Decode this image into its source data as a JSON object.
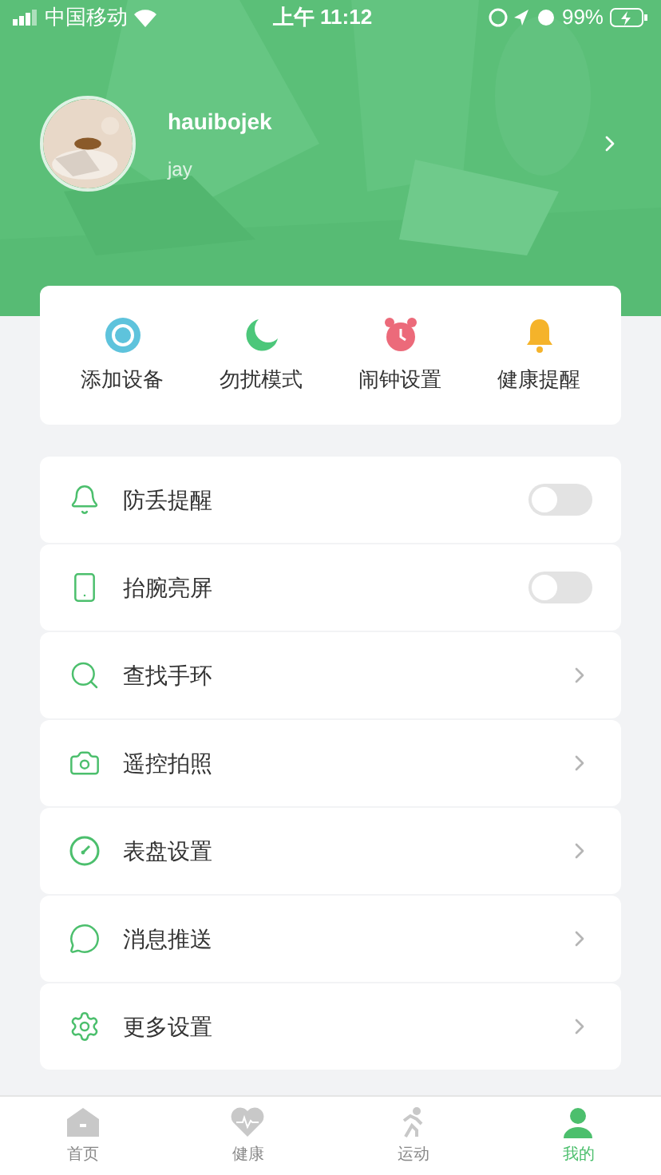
{
  "status_bar": {
    "carrier": "中国移动",
    "time": "上午 11:12",
    "battery": "99%"
  },
  "profile": {
    "username": "hauibojek",
    "nickname": "jay"
  },
  "quick_actions": [
    {
      "label": "添加设备",
      "kind": "device"
    },
    {
      "label": "勿扰模式",
      "kind": "moon"
    },
    {
      "label": "闹钟设置",
      "kind": "alarm"
    },
    {
      "label": "健康提醒",
      "kind": "bell"
    }
  ],
  "settings": [
    {
      "label": "防丢提醒",
      "kind": "toggle",
      "on": false
    },
    {
      "label": "抬腕亮屏",
      "kind": "toggle",
      "on": false
    },
    {
      "label": "查找手环",
      "kind": "link"
    },
    {
      "label": "遥控拍照",
      "kind": "link"
    },
    {
      "label": "表盘设置",
      "kind": "link"
    },
    {
      "label": "消息推送",
      "kind": "link"
    },
    {
      "label": "更多设置",
      "kind": "link"
    }
  ],
  "tab_bar": [
    {
      "label": "首页",
      "selected": false
    },
    {
      "label": "健康",
      "selected": false
    },
    {
      "label": "运动",
      "selected": false
    },
    {
      "label": "我的",
      "selected": true
    }
  ]
}
